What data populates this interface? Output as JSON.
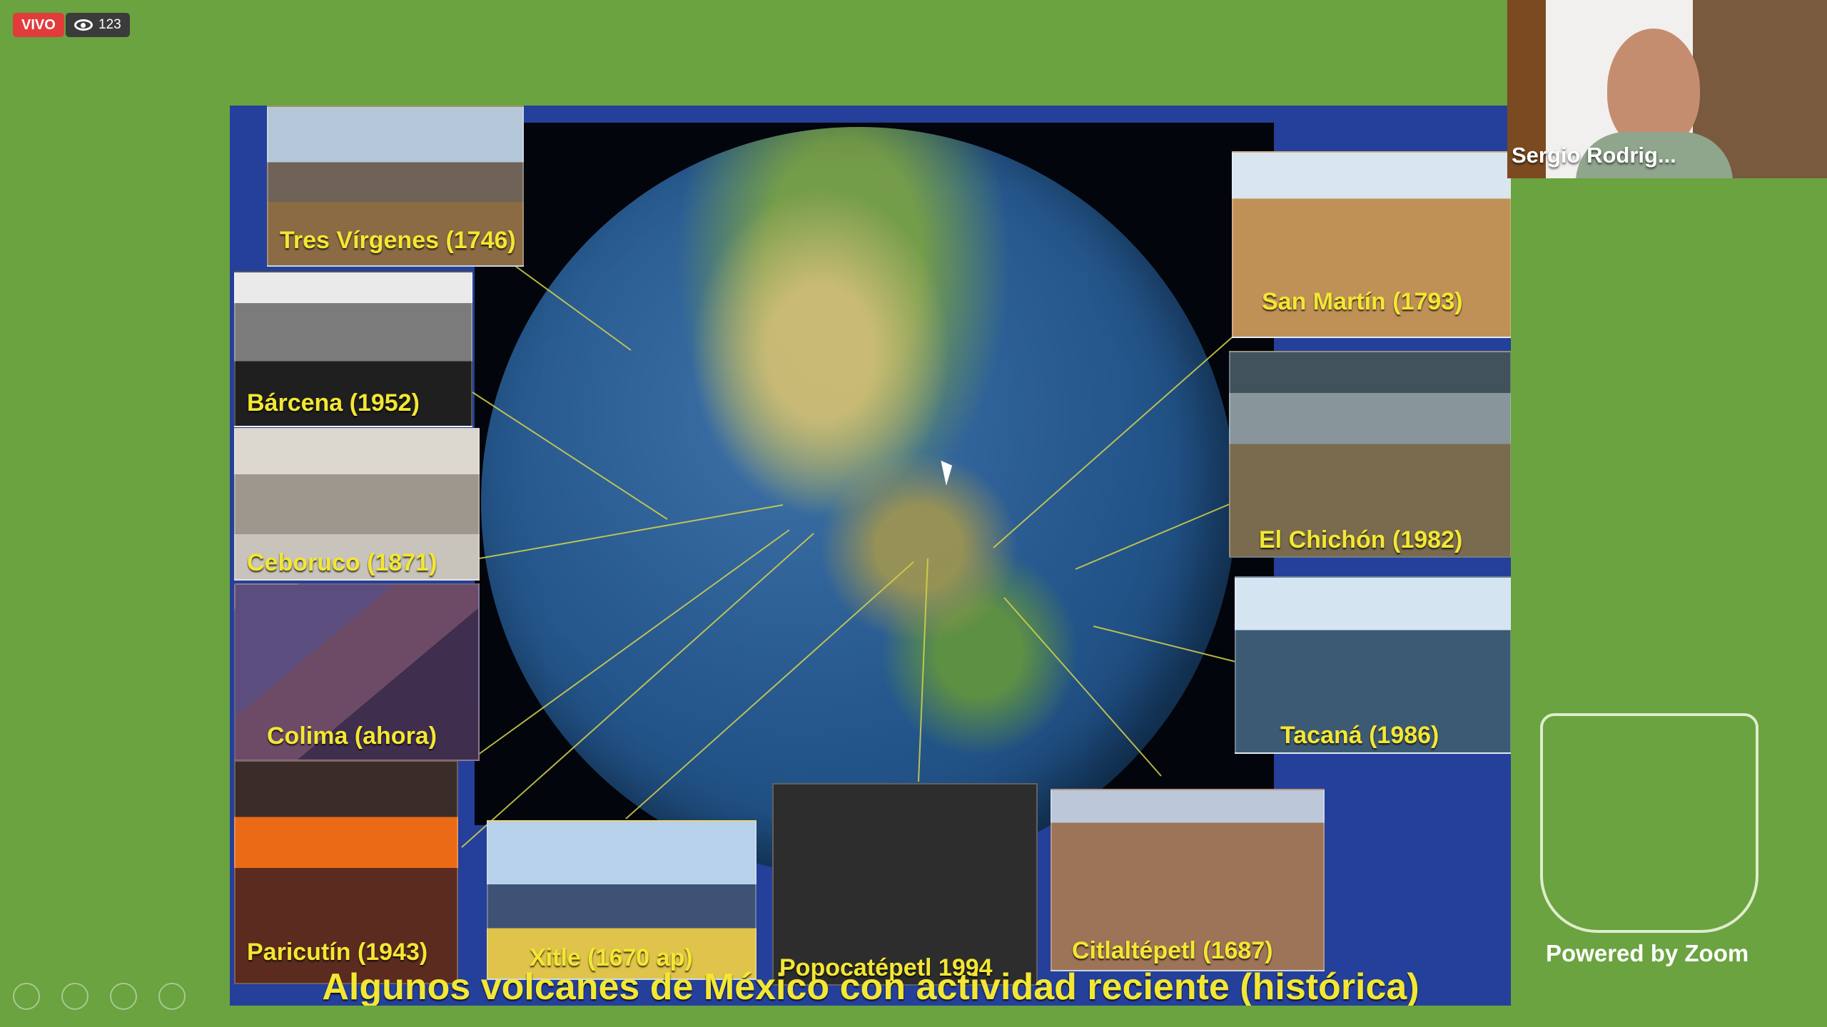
{
  "status": {
    "live_label": "VIVO",
    "viewer_count": "123"
  },
  "slide": {
    "title": "Algunos volcanes de México con actividad reciente (histórica)",
    "labels": [
      "Tres Vírgenes (1746)",
      "Bárcena (1952)",
      "Ceboruco (1871)",
      "Colima (ahora)",
      "Paricutín (1943)",
      "Xitle (1670 ap)",
      "Popocatépetl 1994",
      "Citlaltépetl (1687)",
      "San Martín (1793)",
      "El Chichón (1982)",
      "Tacaná (1986)"
    ]
  },
  "participant": {
    "name": "Sergio Rodrig..."
  },
  "branding": {
    "powered_by": "Powered by Zoom"
  }
}
